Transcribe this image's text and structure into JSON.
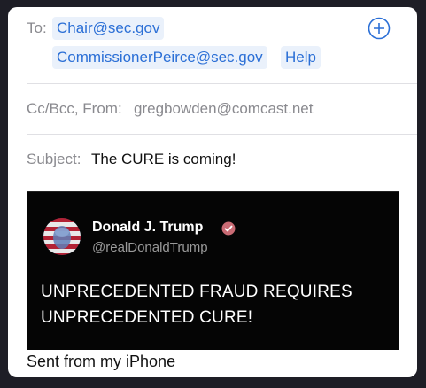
{
  "compose": {
    "to_label": "To:",
    "recipients": [
      "Chair@sec.gov",
      "CommissionerPeirce@sec.gov",
      "Help"
    ],
    "ccbcc_from_label": "Cc/Bcc, From:",
    "from_address": "gregbowden@comcast.net",
    "subject_label": "Subject:",
    "subject_value": "The CURE is coming!",
    "signature": "Sent from my iPhone"
  },
  "tweet": {
    "name": "Donald J. Trump",
    "handle": "@realDonaldTrump",
    "text": "UNPRECEDENTED FRAUD REQUIRES UNPRECEDENTED CURE!"
  },
  "icons": {
    "add_recipient": "plus-circle-icon",
    "verified": "verified-badge-icon"
  },
  "colors": {
    "accent": "#2b6fd6",
    "chip_bg": "#eaf1fb",
    "tweet_bg": "#050505",
    "verified_badge": "#c96b74"
  }
}
